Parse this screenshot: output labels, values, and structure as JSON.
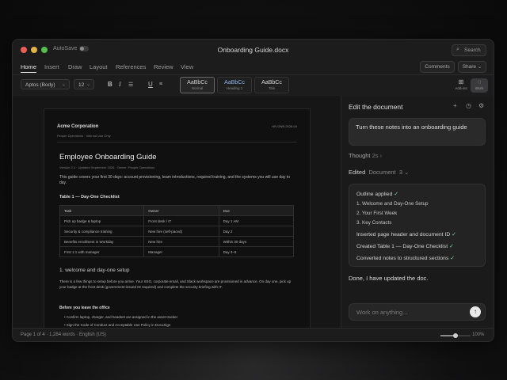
{
  "window": {
    "title": "Onboarding Guide.docx",
    "autosave_label": "AutoSave",
    "search_label": "Search"
  },
  "ribbon": {
    "tabs": [
      "Home",
      "Insert",
      "Draw",
      "Layout",
      "References",
      "Review",
      "View"
    ],
    "active_tab": "Home",
    "comments_label": "Comments",
    "share_label": "Share"
  },
  "toolbar": {
    "font": "Aptos (Body)",
    "size": "12",
    "styles": [
      {
        "sample": "AaBbCc",
        "name": "Normal"
      },
      {
        "sample": "AaBbCc",
        "name": "Heading 1"
      },
      {
        "sample": "AaBbCc",
        "name": "Title"
      }
    ],
    "addins_label": "Add-ins",
    "agent_label": "Work"
  },
  "document": {
    "company": "Acme Corporation",
    "sub": "People Operations · Internal Use Only",
    "doc_id": "HR-ONB-2026-04",
    "title": "Employee Onboarding Guide",
    "meta": "Version 2.4 · Updated September 2026 · Owner: People Operations",
    "intro": "This guide covers your first 30 days: account provisioning, team introductions, required training, and the systems you will use day to day.",
    "table_caption": "Table 1 — Day-One Checklist",
    "table": {
      "headers": [
        "Task",
        "Owner",
        "Due"
      ],
      "rows": [
        [
          "Pick up badge & laptop",
          "Front desk / IT",
          "Day 1 AM"
        ],
        [
          "Security & compliance training",
          "New hire (self-paced)",
          "Day 2"
        ],
        [
          "Benefits enrollment in Workday",
          "New hire",
          "Within 30 days"
        ],
        [
          "First 1:1 with manager",
          "Manager",
          "Day 3–5"
        ]
      ]
    },
    "section_heading": "1. welcome and day-one setup",
    "section_para": "There is a few things to setup before you arrive. Your SSO, corporate email, and Slack workspace are provisioned in advance. On day one, pick up your badge at the front desk (government-issued ID required) and complete the security briefing with IT.",
    "subheading": "Before you leave the office",
    "bullets": [
      "Confirm laptop, charger, and headset are assigned in the asset tracker",
      "Sign the Code of Conduct and Acceptable Use Policy in DocuSign"
    ]
  },
  "panel": {
    "title": "Edit the document",
    "prompt": "Turn these notes into an onboarding guide",
    "thought_label": "Thought",
    "thought_time": "2s",
    "edited_label": "Edited",
    "edited_target": "Document",
    "edited_count": "3",
    "changes": [
      {
        "text": "Outline applied",
        "check": "✓"
      },
      {
        "text": "1. Welcome and Day-One Setup",
        "check": ""
      },
      {
        "text": "2. Your First Week",
        "check": ""
      },
      {
        "text": "3. Key Contacts",
        "check": ""
      },
      {
        "text": "Inserted page header and document ID",
        "check": "✓"
      },
      {
        "text": "Created Table 1 — Day-One Checklist",
        "check": "✓"
      },
      {
        "text": "Converted notes to structured sections",
        "check": "✓"
      }
    ],
    "done_text": "Done, I have updated the doc.",
    "composer_placeholder": "Work on anything..."
  },
  "status": {
    "left": "Page 1 of 4 · 1,284 words · English (US)",
    "zoom": "100%",
    "zoom_level": 0.5
  }
}
